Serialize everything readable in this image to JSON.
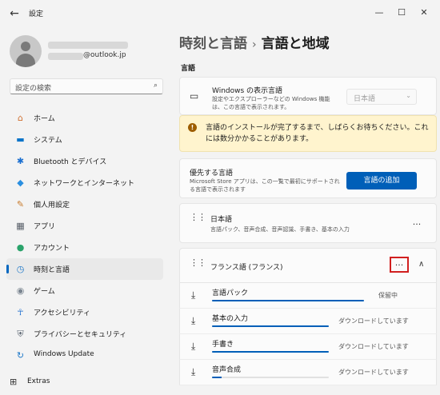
{
  "window": {
    "title": "設定",
    "back_icon": "←",
    "minimize_icon": "—",
    "maximize_icon": "☐",
    "close_icon": "✕"
  },
  "profile": {
    "email_suffix": "@outlook.jp"
  },
  "search": {
    "placeholder": "設定の検索",
    "icon": "⌕"
  },
  "nav": {
    "items": [
      {
        "label": "ホーム",
        "icon": "home-icon",
        "glyph": "⌂",
        "color": "#d07030"
      },
      {
        "label": "システム",
        "icon": "system-icon",
        "glyph": "▬",
        "color": "#0a74c9"
      },
      {
        "label": "Bluetooth とデバイス",
        "icon": "bluetooth-icon",
        "glyph": "✱",
        "color": "#1a6fd0"
      },
      {
        "label": "ネットワークとインターネット",
        "icon": "network-icon",
        "glyph": "◆",
        "color": "#2b8fe0"
      },
      {
        "label": "個人用設定",
        "icon": "personalization-icon",
        "glyph": "✎",
        "color": "#c87a2a"
      },
      {
        "label": "アプリ",
        "icon": "apps-icon",
        "glyph": "▦",
        "color": "#555c66"
      },
      {
        "label": "アカウント",
        "icon": "accounts-icon",
        "glyph": "●",
        "color": "#2aa36b"
      },
      {
        "label": "時刻と言語",
        "icon": "time-language-icon",
        "glyph": "◷",
        "color": "#1f79c9"
      },
      {
        "label": "ゲーム",
        "icon": "gaming-icon",
        "glyph": "◉",
        "color": "#7a8590"
      },
      {
        "label": "アクセシビリティ",
        "icon": "accessibility-icon",
        "glyph": "☥",
        "color": "#1f6fcf"
      },
      {
        "label": "プライバシーとセキュリティ",
        "icon": "privacy-icon",
        "glyph": "⛨",
        "color": "#5a6470"
      },
      {
        "label": "Windows Update",
        "icon": "windows-update-icon",
        "glyph": "↻",
        "color": "#1f79c9"
      }
    ],
    "selected_index": 7
  },
  "extras": {
    "label": "Extras",
    "glyph": "⊞"
  },
  "breadcrumb": {
    "parent": "時刻と言語",
    "separator": "›",
    "current": "言語と地域"
  },
  "language_section": {
    "title": "言語",
    "display_language": {
      "title": "Windows の表示言語",
      "desc_line1": "設定やエクスプローラーなどの Windows 機能",
      "desc_line2": "は、この言語で表示されます。",
      "value": "日本語"
    },
    "warning": {
      "text": "言語のインストールが完了するまで、しばらくお待ちください。これには数分かかることがあります。"
    },
    "preferred": {
      "title": "優先する言語",
      "desc_line1": "Microsoft Store アプリは、この一覧で最初にサポートされ",
      "desc_line2": "る言語で表示されます",
      "button": "言語の追加"
    },
    "japanese": {
      "title": "日本語",
      "desc": "言語パック、音声合成、音声認識、手書き、基本の入力",
      "more": "···"
    },
    "french": {
      "title": "フランス語 (フランス)",
      "more": "···",
      "collapse": "∧"
    },
    "features": [
      {
        "label": "言語パック",
        "status": "保留中",
        "progress": 1.0
      },
      {
        "label": "基本の入力",
        "status": "ダウンロードしています",
        "progress": 1.0
      },
      {
        "label": "手書き",
        "status": "ダウンロードしています",
        "progress": 1.0
      },
      {
        "label": "音声合成",
        "status": "ダウンロードしています",
        "progress": 0.08
      }
    ]
  }
}
